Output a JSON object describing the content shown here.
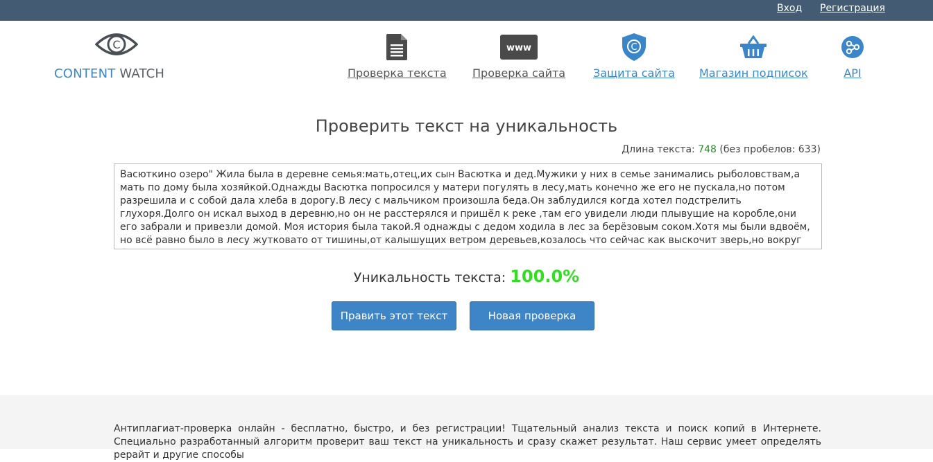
{
  "topbar": {
    "login": "Вход",
    "register": "Регистрация"
  },
  "logo": {
    "part1": "CONTENT",
    "part2": "WATCH",
    "icon": "eye-copyright-icon"
  },
  "nav": [
    {
      "label": "Проверка текста",
      "icon": "document-icon"
    },
    {
      "label": "Проверка сайта",
      "icon": "www-icon"
    },
    {
      "label": "Защита сайта",
      "icon": "shield-copyright-icon"
    },
    {
      "label": "Магазин подписок",
      "icon": "basket-icon"
    },
    {
      "label": "API",
      "icon": "api-share-icon"
    }
  ],
  "main": {
    "title": "Проверить текст на уникальность",
    "length_label": "Длина текста:",
    "length_value": "748",
    "no_spaces_label": "(без пробелов: 633)",
    "text": "Васюткино озеро\" Жила была в деревне семья:мать,отец,их сын Васютка и дед.Мужики у них в семье занимались рыболовствам,а мать по дому была хозяйкой.Однажды Васютка попросился у матери погулять в лесу,мать конечно же его не пускала,но потом разрешила и с собой дала хлеба в дорогу.В лесу с мальчиком произошла беда.Он заблудился когда хотел подстрелить глухоря.Долго он искал выход в деревню,но он не расстерялся и пришёл к реке ,там его увидели люди плывущие на коробле,они его забрали и привезли домой. Моя история была такой.Я однажды с дедом ходила в лес за берёзовым соком.Хотя мы были вдвоём, но всё равно было в лесу жутковато от тишины,от калышущих ветром деревьев,козалось что сейчас как выскочит зверь,но вокруг были только комары и мошки.",
    "uniqueness_label": "Уникальность текста:",
    "uniqueness_value": "100.0%",
    "edit_button": "Править этот текст",
    "new_check_button": "Новая проверка"
  },
  "footer": {
    "text": "Антиплагиат-проверка онлайн - бесплатно, быстро, и без регистрации! Тщательный анализ текста и поиск копий в Интернете. Специально разработанный алгоритм проверит ваш текст на уникальность и сразу скажет результат. Наш сервис умеет определять рерайт и другие способы"
  },
  "colors": {
    "topbar": "#445c73",
    "brand_blue": "#3a86c8",
    "button": "#3d85c6",
    "uniqueness": "#33dd22"
  }
}
